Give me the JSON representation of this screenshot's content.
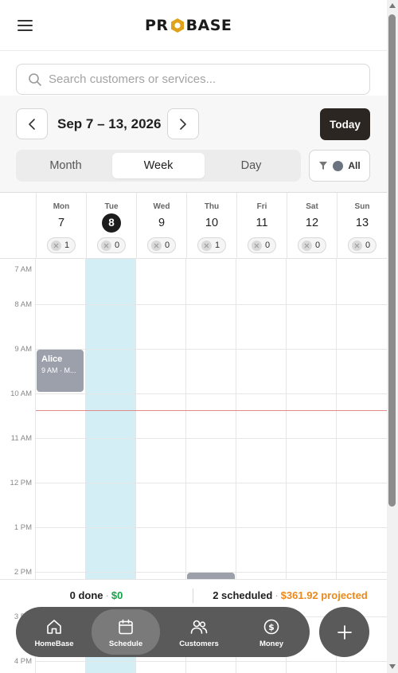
{
  "app": {
    "logo_left": "PR",
    "logo_right": "BASE",
    "brand_color": "#e0a21a"
  },
  "search": {
    "placeholder": "Search customers or services...",
    "value": ""
  },
  "date_nav": {
    "range": "Sep 7 – 13, 2026",
    "today_label": "Today"
  },
  "view_toggle": {
    "options": [
      "Month",
      "Week",
      "Day"
    ],
    "selected": "Week"
  },
  "filter": {
    "label": "All",
    "dot_color": "#6b7280"
  },
  "week": {
    "days": [
      {
        "name": "Mon",
        "num": "7",
        "count": "1"
      },
      {
        "name": "Tue",
        "num": "8",
        "count": "0",
        "today": true
      },
      {
        "name": "Wed",
        "num": "9",
        "count": "0"
      },
      {
        "name": "Thu",
        "num": "10",
        "count": "1"
      },
      {
        "name": "Fri",
        "num": "11",
        "count": "0"
      },
      {
        "name": "Sat",
        "num": "12",
        "count": "0"
      },
      {
        "name": "Sun",
        "num": "13",
        "count": "0"
      }
    ]
  },
  "time_labels": [
    "7 AM",
    "8 AM",
    "9 AM",
    "10 AM",
    "11 AM",
    "12 PM",
    "1 PM",
    "2 PM",
    "3 PM",
    "4 PM"
  ],
  "events": [
    {
      "title": "Alice",
      "time": "9 AM · M..."
    }
  ],
  "summary": {
    "done": "0 done",
    "done_amount": "$0",
    "scheduled": "2 scheduled",
    "projected": "$361.92 projected"
  },
  "bottom_nav": {
    "items": [
      "HomeBase",
      "Schedule",
      "Customers",
      "Money"
    ],
    "active": "Schedule"
  }
}
